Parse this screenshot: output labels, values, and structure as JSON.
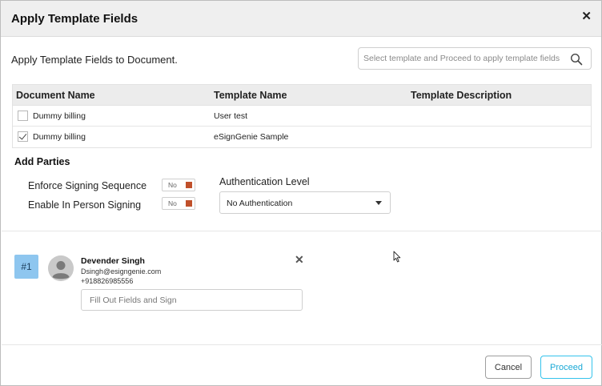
{
  "header": {
    "title": "Apply Template Fields",
    "close_icon": "close-icon"
  },
  "intro": {
    "text": "Apply Template Fields to Document."
  },
  "search": {
    "placeholder": "Select template and Proceed to apply template fields",
    "value": "",
    "icon": "search-icon"
  },
  "table": {
    "columns": [
      "Document Name",
      "Template Name",
      "Template Description"
    ],
    "rows": [
      {
        "checked": false,
        "document": "Dummy billing",
        "template": "User test",
        "description": ""
      },
      {
        "checked": true,
        "document": "Dummy billing",
        "template": "eSignGenie Sample",
        "description": ""
      }
    ]
  },
  "parties_section": {
    "title": "Add Parties",
    "enforce_signing": {
      "label": "Enforce Signing Sequence",
      "state": "No"
    },
    "in_person": {
      "label": "Enable In Person Signing",
      "state": "No"
    },
    "auth": {
      "label": "Authentication Level",
      "selected": "No Authentication"
    }
  },
  "party": {
    "badge": "#1",
    "name": "Devender Singh",
    "email": "Dsingh@esigngenie.com",
    "phone": "+918826985556",
    "role_placeholder": "Fill Out Fields and Sign"
  },
  "footer": {
    "cancel_label": "Cancel",
    "proceed_label": "Proceed"
  },
  "colors": {
    "toggle_knob": "#c0502a",
    "badge_bg": "#8ec6ef",
    "proceed_accent": "#35c3ec"
  }
}
